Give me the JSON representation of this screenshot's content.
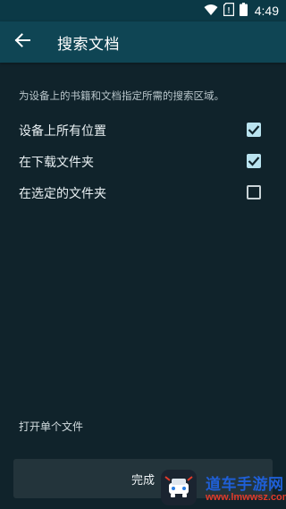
{
  "status_bar": {
    "time": "4:49",
    "icons": [
      "wifi-icon",
      "sim-icon",
      "battery-icon"
    ]
  },
  "toolbar": {
    "title": "搜索文档",
    "back_icon": "arrow-back-icon"
  },
  "description": "为设备上的书籍和文档指定所需的搜索区域。",
  "options": [
    {
      "label": "设备上所有位置",
      "checked": true
    },
    {
      "label": "在下载文件夹",
      "checked": true
    },
    {
      "label": "在选定的文件夹",
      "checked": false
    }
  ],
  "open_single_file": "打开单个文件",
  "done_button": "完成",
  "watermark": {
    "title": "道车手游网",
    "url": "www.lmwwsz.com"
  },
  "colors": {
    "background": "#10232b",
    "toolbar": "#0f4554",
    "status_bar": "#0b3946",
    "checkbox_checked": "#b9e3ef",
    "button": "#23343b"
  }
}
